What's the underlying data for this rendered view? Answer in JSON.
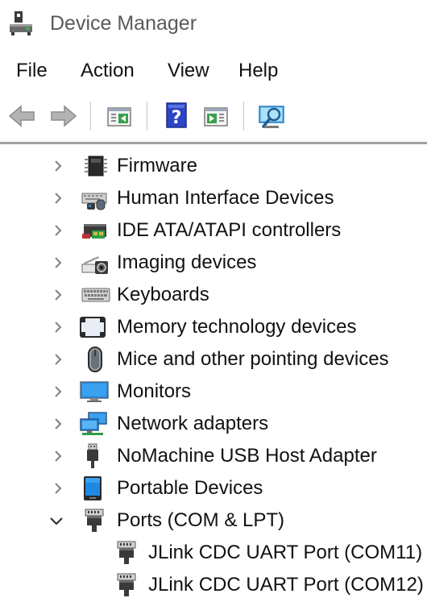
{
  "window": {
    "title": "Device Manager",
    "icon": "device-manager-icon"
  },
  "menu": {
    "items": [
      "File",
      "Action",
      "View",
      "Help"
    ]
  },
  "toolbar": {
    "buttons": [
      {
        "icon": "back-arrow-icon",
        "enabled": false
      },
      {
        "icon": "forward-arrow-icon",
        "enabled": false
      },
      {
        "icon": "show-hide-console-tree-icon",
        "enabled": true
      },
      {
        "icon": "help-icon",
        "enabled": true
      },
      {
        "icon": "properties-pane-icon",
        "enabled": true
      },
      {
        "icon": "scan-hardware-icon",
        "enabled": true
      }
    ]
  },
  "tree": {
    "categories": [
      {
        "label": "Firmware",
        "icon": "firmware-chip-icon",
        "expanded": false
      },
      {
        "label": "Human Interface Devices",
        "icon": "hid-icon",
        "expanded": false
      },
      {
        "label": "IDE ATA/ATAPI controllers",
        "icon": "ide-controller-icon",
        "expanded": false
      },
      {
        "label": "Imaging devices",
        "icon": "camera-icon",
        "expanded": false
      },
      {
        "label": "Keyboards",
        "icon": "keyboard-icon",
        "expanded": false
      },
      {
        "label": "Memory technology devices",
        "icon": "memory-card-icon",
        "expanded": false
      },
      {
        "label": "Mice and other pointing devices",
        "icon": "mouse-icon",
        "expanded": false
      },
      {
        "label": "Monitors",
        "icon": "monitor-icon",
        "expanded": false
      },
      {
        "label": "Network adapters",
        "icon": "network-adapter-icon",
        "expanded": false
      },
      {
        "label": "NoMachine USB Host Adapter",
        "icon": "usb-plug-icon",
        "expanded": false
      },
      {
        "label": "Portable Devices",
        "icon": "portable-device-icon",
        "expanded": false
      },
      {
        "label": "Ports (COM & LPT)",
        "icon": "port-icon",
        "expanded": true
      }
    ],
    "ports_children": [
      {
        "label": "JLink CDC UART Port (COM11)",
        "icon": "port-icon"
      },
      {
        "label": "JLink CDC UART Port (COM12)",
        "icon": "port-icon"
      }
    ]
  },
  "colors": {
    "title_text": "#5a5a5a",
    "chevron": "#808080",
    "help_blue": "#2b45c4",
    "monitor_blue": "#1e88e5"
  }
}
